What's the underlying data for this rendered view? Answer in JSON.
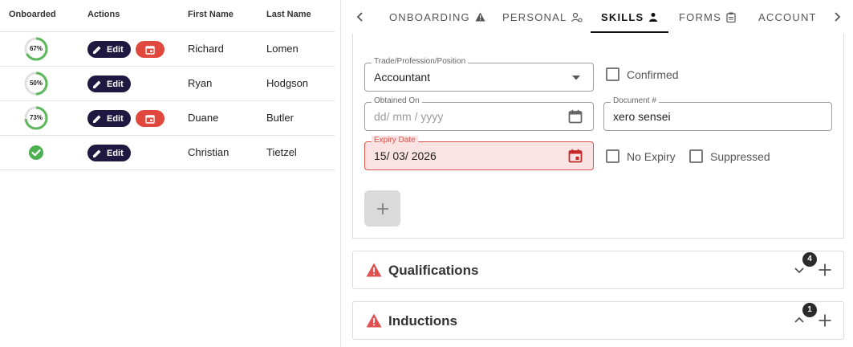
{
  "table": {
    "headers": {
      "onboarded": "Onboarded",
      "actions": "Actions",
      "first_name": "First Name",
      "last_name": "Last Name"
    },
    "rows": [
      {
        "progress": 0.67,
        "progress_label": "67%",
        "edit_label": "Edit",
        "first_name": "Richard",
        "last_name": "Lomen",
        "has_calendar": true
      },
      {
        "progress": 0.5,
        "progress_label": "50%",
        "edit_label": "Edit",
        "first_name": "Ryan",
        "last_name": "Hodgson",
        "has_calendar": false
      },
      {
        "progress": 0.73,
        "progress_label": "73%",
        "edit_label": "Edit",
        "first_name": "Duane",
        "last_name": "Butler",
        "has_calendar": true
      },
      {
        "progress": 1.0,
        "progress_label": "",
        "edit_label": "Edit",
        "first_name": "Christian",
        "last_name": "Tietzel",
        "has_calendar": false,
        "complete": true
      }
    ]
  },
  "tabs": [
    {
      "label": "ONBOARDING",
      "icon": "warning-icon"
    },
    {
      "label": "PERSONAL",
      "icon": "person-settings-icon"
    },
    {
      "label": "SKILLS",
      "icon": "person-icon",
      "active": true
    },
    {
      "label": "FORMS",
      "icon": "clipboard-icon"
    },
    {
      "label": "ACCOUNT",
      "icon": ""
    }
  ],
  "skills_form": {
    "trade_label": "Trade/Profession/Position",
    "trade_value": "Accountant",
    "confirmed_label": "Confirmed",
    "obtained_label": "Obtained On",
    "obtained_placeholder": "dd/ mm / yyyy",
    "document_label": "Document #",
    "document_value": "xero sensei",
    "expiry_label": "Expiry Date",
    "expiry_value": "15/ 03/ 2026",
    "no_expiry_label": "No Expiry",
    "suppressed_label": "Suppressed"
  },
  "panels": {
    "qualifications": {
      "title": "Qualifications",
      "count": "4"
    },
    "inductions": {
      "title": "Inductions",
      "count": "1"
    }
  },
  "colors": {
    "edit_button": "#1f1840",
    "calendar_button": "#e0483e",
    "progress": "#5cb85c",
    "error": "#d9534f"
  }
}
